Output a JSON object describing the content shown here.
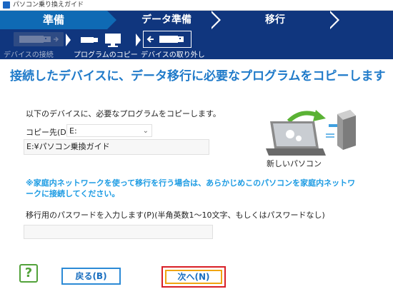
{
  "window": {
    "title": "パソコン乗り換えガイド"
  },
  "steps": [
    {
      "label": "準備",
      "state": "active"
    },
    {
      "label": "データ準備",
      "state": "inactive"
    },
    {
      "label": "移行",
      "state": "inactive"
    }
  ],
  "substeps": [
    {
      "label": "デバイスの接続",
      "icon": "usb-device-icon",
      "state": "done"
    },
    {
      "label": "プログラムのコピー",
      "icon": "usb-to-monitor-icon",
      "state": "current"
    },
    {
      "label": "デバイスの取り外し",
      "icon": "usb-remove-icon",
      "state": "next"
    }
  ],
  "heading": "接続したデバイスに、データ移行に必要なプログラムをコピーします",
  "intro": "以下のデバイスに、必要なプログラムをコピーします。",
  "destination": {
    "label": "コピー先(D):",
    "value": "E:",
    "path": "E:¥パソコン乗換ガイド"
  },
  "note": "※家庭内ネットワークを使って移行を行う場合は、あらかじめこのパソコンを家庭内ネットワークに接続してください。",
  "password": {
    "label": "移行用のパスワードを入力します(P)(半角英数1～10文字、もしくはパスワードなし)",
    "value": ""
  },
  "illustration": {
    "caption": "新しいパソコン"
  },
  "buttons": {
    "help": "?",
    "back": "戻る(B)",
    "next": "次へ(N)"
  },
  "colors": {
    "header_bg": "#10367e",
    "active_step": "#0f6ab4",
    "heading": "#1f7ac9",
    "note": "#1c9be3",
    "highlight": "#d81f26"
  }
}
